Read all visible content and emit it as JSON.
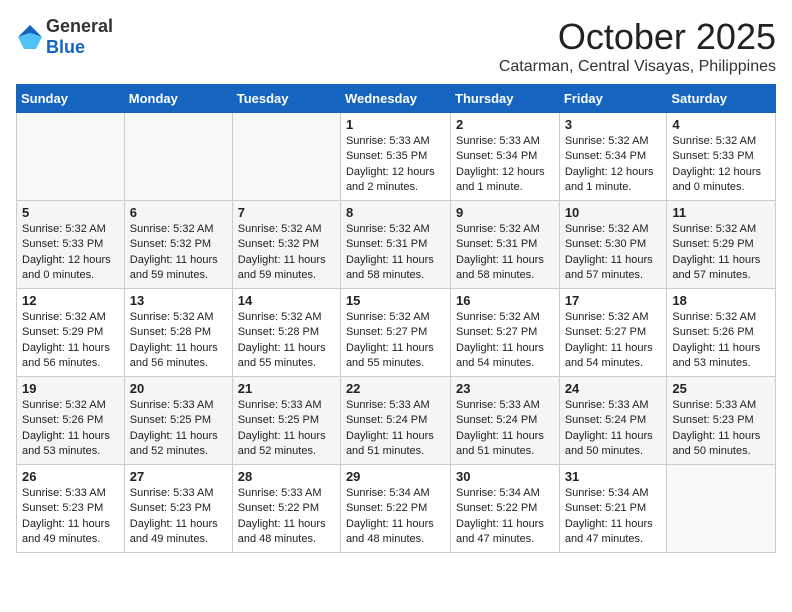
{
  "header": {
    "logo_general": "General",
    "logo_blue": "Blue",
    "month": "October 2025",
    "location": "Catarman, Central Visayas, Philippines"
  },
  "weekdays": [
    "Sunday",
    "Monday",
    "Tuesday",
    "Wednesday",
    "Thursday",
    "Friday",
    "Saturday"
  ],
  "weeks": [
    [
      {
        "day": "",
        "info": ""
      },
      {
        "day": "",
        "info": ""
      },
      {
        "day": "",
        "info": ""
      },
      {
        "day": "1",
        "info": "Sunrise: 5:33 AM\nSunset: 5:35 PM\nDaylight: 12 hours and 2 minutes."
      },
      {
        "day": "2",
        "info": "Sunrise: 5:33 AM\nSunset: 5:34 PM\nDaylight: 12 hours and 1 minute."
      },
      {
        "day": "3",
        "info": "Sunrise: 5:32 AM\nSunset: 5:34 PM\nDaylight: 12 hours and 1 minute."
      },
      {
        "day": "4",
        "info": "Sunrise: 5:32 AM\nSunset: 5:33 PM\nDaylight: 12 hours and 0 minutes."
      }
    ],
    [
      {
        "day": "5",
        "info": "Sunrise: 5:32 AM\nSunset: 5:33 PM\nDaylight: 12 hours and 0 minutes."
      },
      {
        "day": "6",
        "info": "Sunrise: 5:32 AM\nSunset: 5:32 PM\nDaylight: 11 hours and 59 minutes."
      },
      {
        "day": "7",
        "info": "Sunrise: 5:32 AM\nSunset: 5:32 PM\nDaylight: 11 hours and 59 minutes."
      },
      {
        "day": "8",
        "info": "Sunrise: 5:32 AM\nSunset: 5:31 PM\nDaylight: 11 hours and 58 minutes."
      },
      {
        "day": "9",
        "info": "Sunrise: 5:32 AM\nSunset: 5:31 PM\nDaylight: 11 hours and 58 minutes."
      },
      {
        "day": "10",
        "info": "Sunrise: 5:32 AM\nSunset: 5:30 PM\nDaylight: 11 hours and 57 minutes."
      },
      {
        "day": "11",
        "info": "Sunrise: 5:32 AM\nSunset: 5:29 PM\nDaylight: 11 hours and 57 minutes."
      }
    ],
    [
      {
        "day": "12",
        "info": "Sunrise: 5:32 AM\nSunset: 5:29 PM\nDaylight: 11 hours and 56 minutes."
      },
      {
        "day": "13",
        "info": "Sunrise: 5:32 AM\nSunset: 5:28 PM\nDaylight: 11 hours and 56 minutes."
      },
      {
        "day": "14",
        "info": "Sunrise: 5:32 AM\nSunset: 5:28 PM\nDaylight: 11 hours and 55 minutes."
      },
      {
        "day": "15",
        "info": "Sunrise: 5:32 AM\nSunset: 5:27 PM\nDaylight: 11 hours and 55 minutes."
      },
      {
        "day": "16",
        "info": "Sunrise: 5:32 AM\nSunset: 5:27 PM\nDaylight: 11 hours and 54 minutes."
      },
      {
        "day": "17",
        "info": "Sunrise: 5:32 AM\nSunset: 5:27 PM\nDaylight: 11 hours and 54 minutes."
      },
      {
        "day": "18",
        "info": "Sunrise: 5:32 AM\nSunset: 5:26 PM\nDaylight: 11 hours and 53 minutes."
      }
    ],
    [
      {
        "day": "19",
        "info": "Sunrise: 5:32 AM\nSunset: 5:26 PM\nDaylight: 11 hours and 53 minutes."
      },
      {
        "day": "20",
        "info": "Sunrise: 5:33 AM\nSunset: 5:25 PM\nDaylight: 11 hours and 52 minutes."
      },
      {
        "day": "21",
        "info": "Sunrise: 5:33 AM\nSunset: 5:25 PM\nDaylight: 11 hours and 52 minutes."
      },
      {
        "day": "22",
        "info": "Sunrise: 5:33 AM\nSunset: 5:24 PM\nDaylight: 11 hours and 51 minutes."
      },
      {
        "day": "23",
        "info": "Sunrise: 5:33 AM\nSunset: 5:24 PM\nDaylight: 11 hours and 51 minutes."
      },
      {
        "day": "24",
        "info": "Sunrise: 5:33 AM\nSunset: 5:24 PM\nDaylight: 11 hours and 50 minutes."
      },
      {
        "day": "25",
        "info": "Sunrise: 5:33 AM\nSunset: 5:23 PM\nDaylight: 11 hours and 50 minutes."
      }
    ],
    [
      {
        "day": "26",
        "info": "Sunrise: 5:33 AM\nSunset: 5:23 PM\nDaylight: 11 hours and 49 minutes."
      },
      {
        "day": "27",
        "info": "Sunrise: 5:33 AM\nSunset: 5:23 PM\nDaylight: 11 hours and 49 minutes."
      },
      {
        "day": "28",
        "info": "Sunrise: 5:33 AM\nSunset: 5:22 PM\nDaylight: 11 hours and 48 minutes."
      },
      {
        "day": "29",
        "info": "Sunrise: 5:34 AM\nSunset: 5:22 PM\nDaylight: 11 hours and 48 minutes."
      },
      {
        "day": "30",
        "info": "Sunrise: 5:34 AM\nSunset: 5:22 PM\nDaylight: 11 hours and 47 minutes."
      },
      {
        "day": "31",
        "info": "Sunrise: 5:34 AM\nSunset: 5:21 PM\nDaylight: 11 hours and 47 minutes."
      },
      {
        "day": "",
        "info": ""
      }
    ]
  ]
}
